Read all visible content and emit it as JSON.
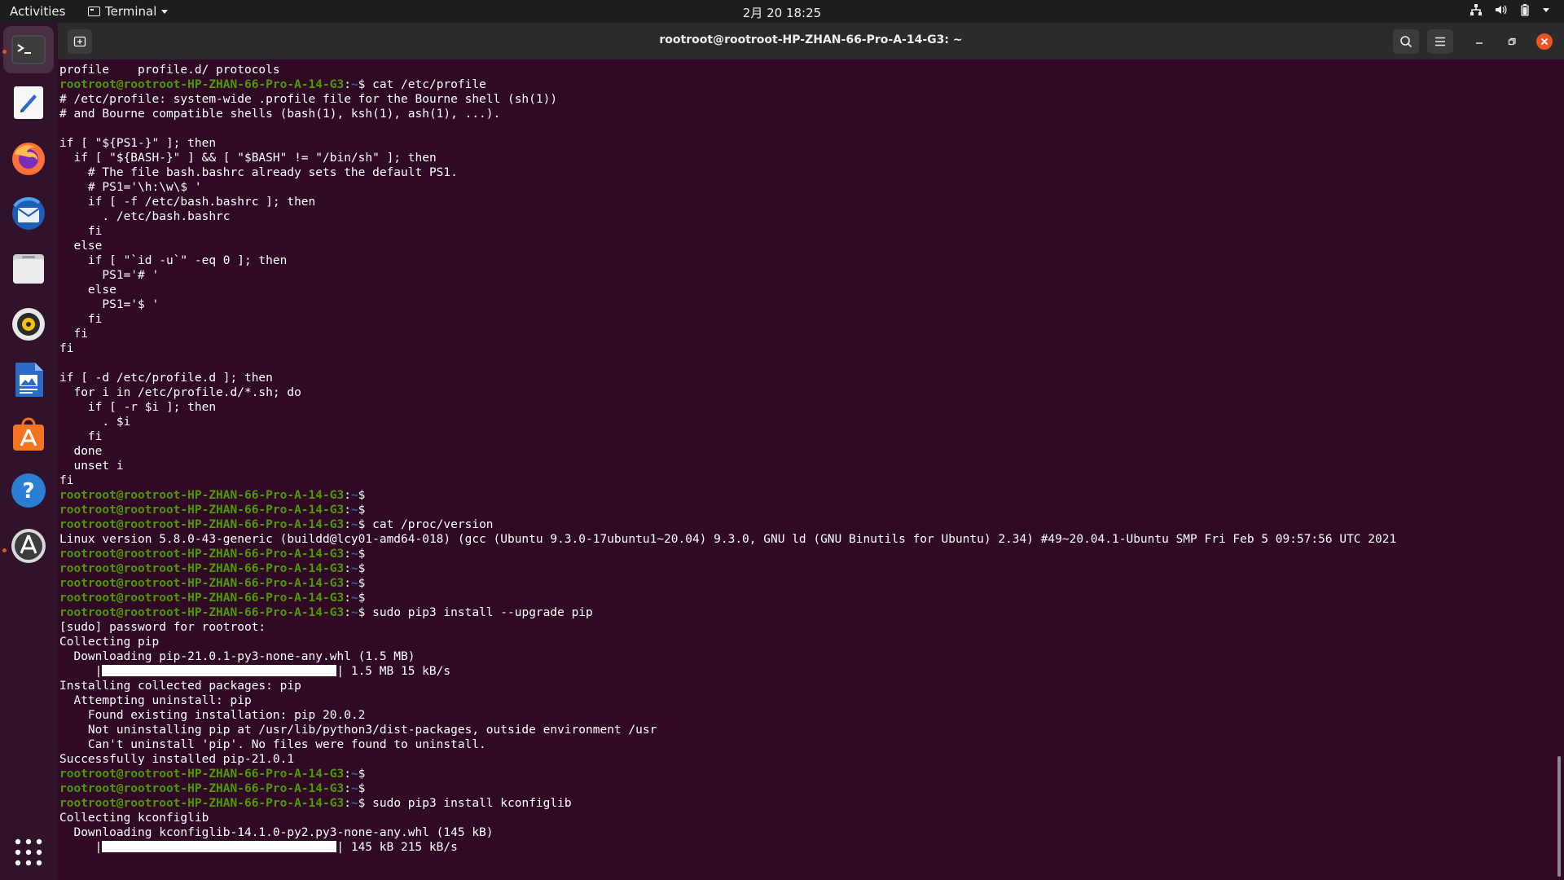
{
  "topbar": {
    "activities": "Activities",
    "app_name": "Terminal",
    "clock": "2月 20  18:25"
  },
  "window": {
    "title": "rootroot@rootroot-HP-ZHAN-66-Pro-A-14-G3: ~"
  },
  "dock": {
    "items": [
      "Terminal",
      "Text Editor",
      "Firefox",
      "Thunderbird",
      "Files",
      "Rhythmbox",
      "LibreOffice Writer",
      "Ubuntu Software",
      "Help",
      "Software Updater"
    ],
    "show_apps": "Show Applications"
  },
  "colors": {
    "terminal_bg": "#300a24",
    "prompt_user": "#4e9a06",
    "prompt_path": "#3465a4",
    "accent": "#e95420"
  },
  "terminal": {
    "prompt_user": "rootroot@rootroot-HP-ZHAN-66-Pro-A-14-G3",
    "prompt_path": "~",
    "lines": [
      {
        "t": "out",
        "text": "profile    profile.d/ protocols"
      },
      {
        "t": "cmd",
        "text": " cat /etc/profile"
      },
      {
        "t": "out",
        "text": "# /etc/profile: system-wide .profile file for the Bourne shell (sh(1))"
      },
      {
        "t": "out",
        "text": "# and Bourne compatible shells (bash(1), ksh(1), ash(1), ...)."
      },
      {
        "t": "out",
        "text": ""
      },
      {
        "t": "out",
        "text": "if [ \"${PS1-}\" ]; then"
      },
      {
        "t": "out",
        "text": "  if [ \"${BASH-}\" ] && [ \"$BASH\" != \"/bin/sh\" ]; then"
      },
      {
        "t": "out",
        "text": "    # The file bash.bashrc already sets the default PS1."
      },
      {
        "t": "out",
        "text": "    # PS1='\\h:\\w\\$ '"
      },
      {
        "t": "out",
        "text": "    if [ -f /etc/bash.bashrc ]; then"
      },
      {
        "t": "out",
        "text": "      . /etc/bash.bashrc"
      },
      {
        "t": "out",
        "text": "    fi"
      },
      {
        "t": "out",
        "text": "  else"
      },
      {
        "t": "out",
        "text": "    if [ \"`id -u`\" -eq 0 ]; then"
      },
      {
        "t": "out",
        "text": "      PS1='# '"
      },
      {
        "t": "out",
        "text": "    else"
      },
      {
        "t": "out",
        "text": "      PS1='$ '"
      },
      {
        "t": "out",
        "text": "    fi"
      },
      {
        "t": "out",
        "text": "  fi"
      },
      {
        "t": "out",
        "text": "fi"
      },
      {
        "t": "out",
        "text": ""
      },
      {
        "t": "out",
        "text": "if [ -d /etc/profile.d ]; then"
      },
      {
        "t": "out",
        "text": "  for i in /etc/profile.d/*.sh; do"
      },
      {
        "t": "out",
        "text": "    if [ -r $i ]; then"
      },
      {
        "t": "out",
        "text": "      . $i"
      },
      {
        "t": "out",
        "text": "    fi"
      },
      {
        "t": "out",
        "text": "  done"
      },
      {
        "t": "out",
        "text": "  unset i"
      },
      {
        "t": "out",
        "text": "fi"
      },
      {
        "t": "cmd",
        "text": ""
      },
      {
        "t": "cmd",
        "text": ""
      },
      {
        "t": "cmd",
        "text": " cat /proc/version"
      },
      {
        "t": "out",
        "text": "Linux version 5.8.0-43-generic (buildd@lcy01-amd64-018) (gcc (Ubuntu 9.3.0-17ubuntu1~20.04) 9.3.0, GNU ld (GNU Binutils for Ubuntu) 2.34) #49~20.04.1-Ubuntu SMP Fri Feb 5 09:57:56 UTC 2021"
      },
      {
        "t": "cmd",
        "text": ""
      },
      {
        "t": "cmd",
        "text": ""
      },
      {
        "t": "cmd",
        "text": ""
      },
      {
        "t": "cmd",
        "text": ""
      },
      {
        "t": "cmd",
        "text": " sudo pip3 install --upgrade pip"
      },
      {
        "t": "out",
        "text": "[sudo] password for rootroot:"
      },
      {
        "t": "out",
        "text": "Collecting pip"
      },
      {
        "t": "out",
        "text": "  Downloading pip-21.0.1-py3-none-any.whl (1.5 MB)"
      },
      {
        "t": "bar",
        "text": "| 1.5 MB 15 kB/s"
      },
      {
        "t": "out",
        "text": "Installing collected packages: pip"
      },
      {
        "t": "out",
        "text": "  Attempting uninstall: pip"
      },
      {
        "t": "out",
        "text": "    Found existing installation: pip 20.0.2"
      },
      {
        "t": "out",
        "text": "    Not uninstalling pip at /usr/lib/python3/dist-packages, outside environment /usr"
      },
      {
        "t": "out",
        "text": "    Can't uninstall 'pip'. No files were found to uninstall."
      },
      {
        "t": "out",
        "text": "Successfully installed pip-21.0.1"
      },
      {
        "t": "cmd",
        "text": ""
      },
      {
        "t": "cmd",
        "text": ""
      },
      {
        "t": "cmd",
        "text": " sudo pip3 install kconfiglib"
      },
      {
        "t": "out",
        "text": "Collecting kconfiglib"
      },
      {
        "t": "out",
        "text": "  Downloading kconfiglib-14.1.0-py2.py3-none-any.whl (145 kB)"
      },
      {
        "t": "bar",
        "text": "| 145 kB 215 kB/s"
      }
    ]
  }
}
